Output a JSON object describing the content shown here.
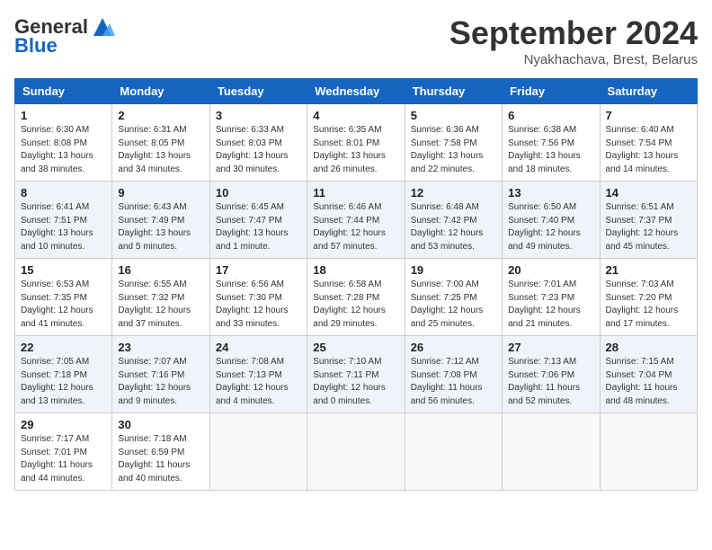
{
  "header": {
    "logo_general": "General",
    "logo_blue": "Blue",
    "month_title": "September 2024",
    "subtitle": "Nyakhachava, Brest, Belarus"
  },
  "days_of_week": [
    "Sunday",
    "Monday",
    "Tuesday",
    "Wednesday",
    "Thursday",
    "Friday",
    "Saturday"
  ],
  "weeks": [
    [
      {
        "day": "1",
        "info": "Sunrise: 6:30 AM\nSunset: 8:08 PM\nDaylight: 13 hours\nand 38 minutes."
      },
      {
        "day": "2",
        "info": "Sunrise: 6:31 AM\nSunset: 8:05 PM\nDaylight: 13 hours\nand 34 minutes."
      },
      {
        "day": "3",
        "info": "Sunrise: 6:33 AM\nSunset: 8:03 PM\nDaylight: 13 hours\nand 30 minutes."
      },
      {
        "day": "4",
        "info": "Sunrise: 6:35 AM\nSunset: 8:01 PM\nDaylight: 13 hours\nand 26 minutes."
      },
      {
        "day": "5",
        "info": "Sunrise: 6:36 AM\nSunset: 7:58 PM\nDaylight: 13 hours\nand 22 minutes."
      },
      {
        "day": "6",
        "info": "Sunrise: 6:38 AM\nSunset: 7:56 PM\nDaylight: 13 hours\nand 18 minutes."
      },
      {
        "day": "7",
        "info": "Sunrise: 6:40 AM\nSunset: 7:54 PM\nDaylight: 13 hours\nand 14 minutes."
      }
    ],
    [
      {
        "day": "8",
        "info": "Sunrise: 6:41 AM\nSunset: 7:51 PM\nDaylight: 13 hours\nand 10 minutes."
      },
      {
        "day": "9",
        "info": "Sunrise: 6:43 AM\nSunset: 7:49 PM\nDaylight: 13 hours\nand 5 minutes."
      },
      {
        "day": "10",
        "info": "Sunrise: 6:45 AM\nSunset: 7:47 PM\nDaylight: 13 hours\nand 1 minute."
      },
      {
        "day": "11",
        "info": "Sunrise: 6:46 AM\nSunset: 7:44 PM\nDaylight: 12 hours\nand 57 minutes."
      },
      {
        "day": "12",
        "info": "Sunrise: 6:48 AM\nSunset: 7:42 PM\nDaylight: 12 hours\nand 53 minutes."
      },
      {
        "day": "13",
        "info": "Sunrise: 6:50 AM\nSunset: 7:40 PM\nDaylight: 12 hours\nand 49 minutes."
      },
      {
        "day": "14",
        "info": "Sunrise: 6:51 AM\nSunset: 7:37 PM\nDaylight: 12 hours\nand 45 minutes."
      }
    ],
    [
      {
        "day": "15",
        "info": "Sunrise: 6:53 AM\nSunset: 7:35 PM\nDaylight: 12 hours\nand 41 minutes."
      },
      {
        "day": "16",
        "info": "Sunrise: 6:55 AM\nSunset: 7:32 PM\nDaylight: 12 hours\nand 37 minutes."
      },
      {
        "day": "17",
        "info": "Sunrise: 6:56 AM\nSunset: 7:30 PM\nDaylight: 12 hours\nand 33 minutes."
      },
      {
        "day": "18",
        "info": "Sunrise: 6:58 AM\nSunset: 7:28 PM\nDaylight: 12 hours\nand 29 minutes."
      },
      {
        "day": "19",
        "info": "Sunrise: 7:00 AM\nSunset: 7:25 PM\nDaylight: 12 hours\nand 25 minutes."
      },
      {
        "day": "20",
        "info": "Sunrise: 7:01 AM\nSunset: 7:23 PM\nDaylight: 12 hours\nand 21 minutes."
      },
      {
        "day": "21",
        "info": "Sunrise: 7:03 AM\nSunset: 7:20 PM\nDaylight: 12 hours\nand 17 minutes."
      }
    ],
    [
      {
        "day": "22",
        "info": "Sunrise: 7:05 AM\nSunset: 7:18 PM\nDaylight: 12 hours\nand 13 minutes."
      },
      {
        "day": "23",
        "info": "Sunrise: 7:07 AM\nSunset: 7:16 PM\nDaylight: 12 hours\nand 9 minutes."
      },
      {
        "day": "24",
        "info": "Sunrise: 7:08 AM\nSunset: 7:13 PM\nDaylight: 12 hours\nand 4 minutes."
      },
      {
        "day": "25",
        "info": "Sunrise: 7:10 AM\nSunset: 7:11 PM\nDaylight: 12 hours\nand 0 minutes."
      },
      {
        "day": "26",
        "info": "Sunrise: 7:12 AM\nSunset: 7:08 PM\nDaylight: 11 hours\nand 56 minutes."
      },
      {
        "day": "27",
        "info": "Sunrise: 7:13 AM\nSunset: 7:06 PM\nDaylight: 11 hours\nand 52 minutes."
      },
      {
        "day": "28",
        "info": "Sunrise: 7:15 AM\nSunset: 7:04 PM\nDaylight: 11 hours\nand 48 minutes."
      }
    ],
    [
      {
        "day": "29",
        "info": "Sunrise: 7:17 AM\nSunset: 7:01 PM\nDaylight: 11 hours\nand 44 minutes."
      },
      {
        "day": "30",
        "info": "Sunrise: 7:18 AM\nSunset: 6:59 PM\nDaylight: 11 hours\nand 40 minutes."
      },
      {
        "day": "",
        "info": ""
      },
      {
        "day": "",
        "info": ""
      },
      {
        "day": "",
        "info": ""
      },
      {
        "day": "",
        "info": ""
      },
      {
        "day": "",
        "info": ""
      }
    ]
  ]
}
